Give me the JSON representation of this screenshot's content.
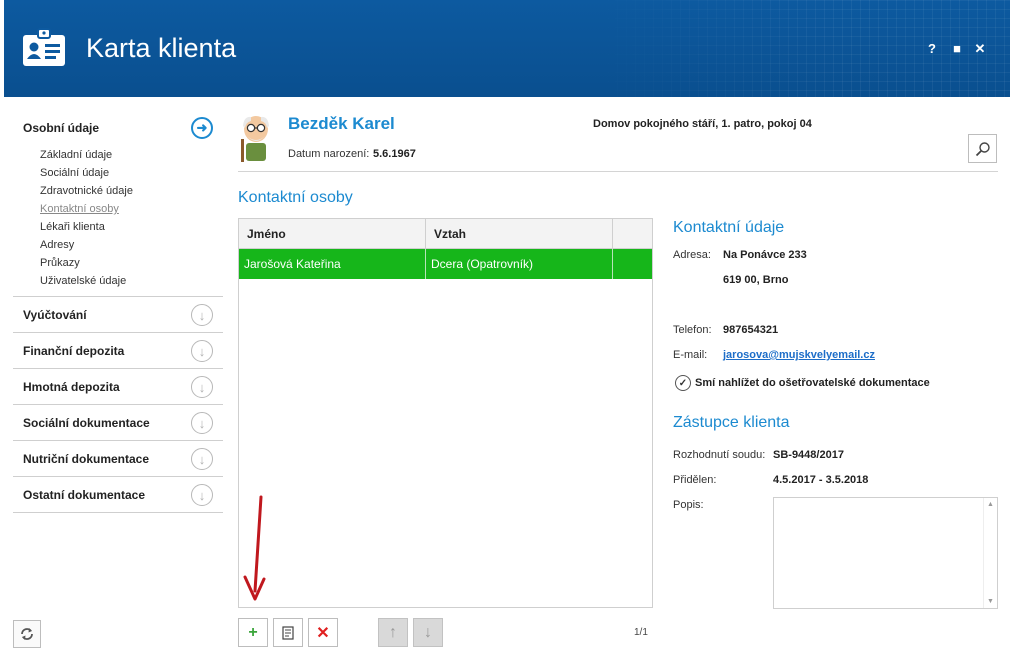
{
  "window": {
    "title": "Karta klienta",
    "controls": [
      "?",
      "■",
      "✕"
    ]
  },
  "sidebar": {
    "active_section": "Osobní údaje",
    "sub_items": [
      "Základní údaje",
      "Sociální údaje",
      "Zdravotnické údaje",
      "Kontaktní osoby",
      "Lékaři klienta",
      "Adresy",
      "Průkazy",
      "Uživatelské údaje"
    ],
    "current_sub_item": "Kontaktní osoby",
    "sections": [
      "Vyúčtování",
      "Finanční depozita",
      "Hmotná depozita",
      "Sociální dokumentace",
      "Nutriční dokumentace",
      "Ostatní dokumentace"
    ]
  },
  "client": {
    "name": "Bezděk Karel",
    "dob_label": "Datum narození:",
    "dob": "5.6.1967",
    "location": "Domov pokojného stáří, 1. patro, pokoj 04"
  },
  "contacts": {
    "title": "Kontaktní osoby",
    "columns": [
      "Jméno",
      "Vztah",
      ""
    ],
    "rows": [
      {
        "name": "Jarošová Kateřina",
        "relation": "Dcera (Opatrovník)"
      }
    ],
    "pager": "1/1",
    "toolbar": {
      "add": "+",
      "edit": "edit",
      "delete": "✕",
      "up": "↑",
      "down": "↓"
    }
  },
  "contact_details": {
    "title": "Kontaktní údaje",
    "address_label": "Adresa:",
    "address_line1": "Na Ponávce 233",
    "address_line2": "619 00, Brno",
    "phone_label": "Telefon:",
    "phone": "987654321",
    "email_label": "E-mail:",
    "email": "jarosova@mujskvelyemail.cz",
    "permission": "Smí nahlížet do ošetřovatelské dokumentace"
  },
  "representative": {
    "title": "Zástupce klienta",
    "decision_label": "Rozhodnutí soudu:",
    "decision": "SB-9448/2017",
    "assigned_label": "Přidělen:",
    "assigned": "4.5.2017 - 3.5.2018",
    "note_label": "Popis:",
    "note": ""
  },
  "colors": {
    "header": "#0d5aa0",
    "accent": "#1c8ad0",
    "selected_row": "#16b61a",
    "add": "#3aa53a",
    "delete": "#e02020",
    "annotation": "#c0181e"
  },
  "icons": {
    "app": "id-card-icon",
    "nav_active": "arrow-right-circle-icon",
    "nav": "arrow-down-circle-icon",
    "search": "magnifier-icon",
    "refresh": "refresh-icon"
  }
}
